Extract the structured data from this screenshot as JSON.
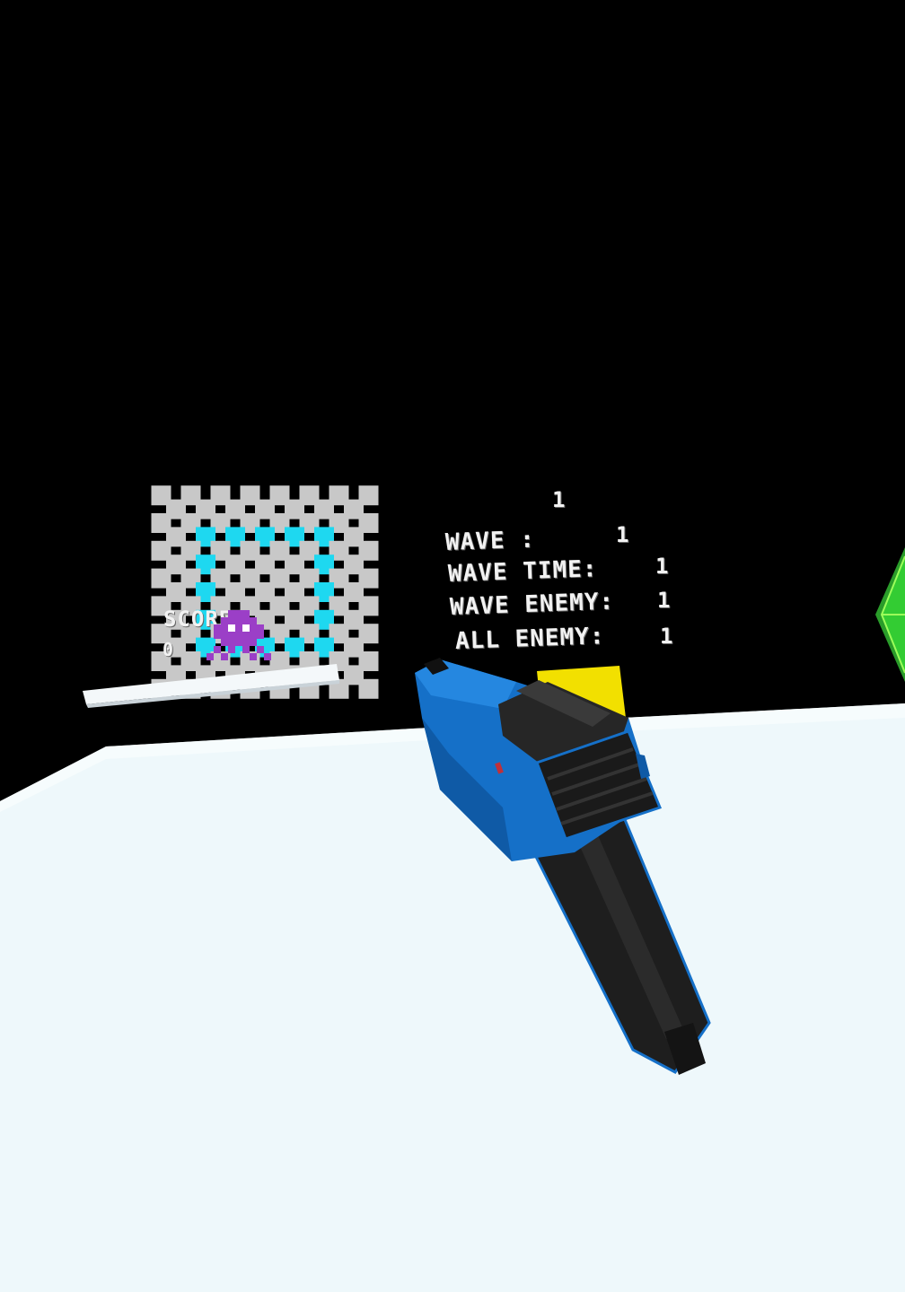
{
  "hud": {
    "wave_top_value": "1",
    "wave_label": "WAVE :",
    "wave_value": "1",
    "wave_time_label": "WAVE TIME:",
    "wave_time_value": "1",
    "wave_enemy_label": "WAVE ENEMY:",
    "wave_enemy_value": "1",
    "all_enemy_label": "ALL ENEMY:",
    "all_enemy_value": "1"
  },
  "score": {
    "label": "SCORE",
    "value": "0"
  },
  "colors": {
    "background": "#000000",
    "floor": "#eef8fb",
    "board_gray": "#c8c8c8",
    "board_cyan": "#1ed8f0",
    "enemy_purple": "#9b3fc7",
    "blaster_blue": "#1570c8",
    "blaster_black": "#1e1e1e",
    "crystal_green": "#33cc33",
    "target_yellow": "#f2e000"
  },
  "icons": {
    "enemy": "purple-octopus-enemy-icon",
    "weapon": "blue-blaster-icon",
    "target": "pixel-diamond-target-icon",
    "crystal": "green-crystal-icon"
  }
}
